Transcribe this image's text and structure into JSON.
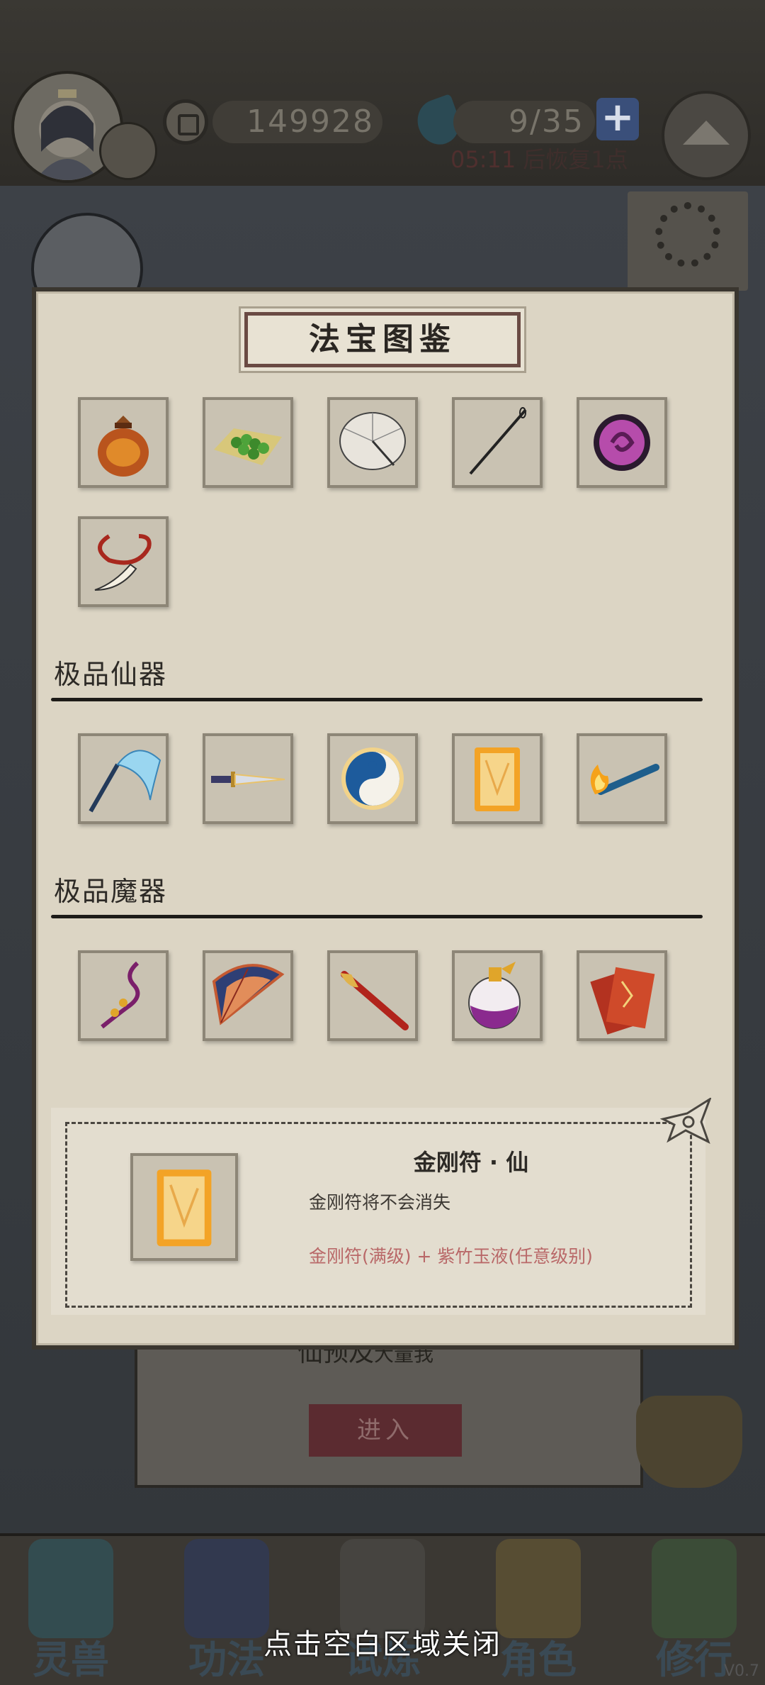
{
  "header": {
    "coins": "149928",
    "stamina": "9/35",
    "add_label": "+",
    "timer": "05:11",
    "timer_suffix": "后恢复1点"
  },
  "modal": {
    "title": "法宝图鉴",
    "sections": [
      {
        "label": "",
        "items": [
          "treasure-bag-icon",
          "jade-beads-icon",
          "paper-umbrella-icon",
          "needle-icon",
          "purple-disc-icon",
          "fang-pendant-icon"
        ]
      },
      {
        "label": "极品仙器",
        "items": [
          "whisk-icon",
          "dagger-icon",
          "yin-yang-icon",
          "golden-talisman-icon",
          "fire-torch-icon"
        ]
      },
      {
        "label": "极品魔器",
        "items": [
          "purple-tassel-icon",
          "blue-fan-icon",
          "red-flute-icon",
          "purple-potion-icon",
          "red-talisman-icon"
        ]
      }
    ],
    "detail": {
      "name": "金刚符 · 仙",
      "description": "金刚符将不会消失",
      "recipe": "金刚符(满级) + 紫竹玉液(任意级别)",
      "icon": "golden-talisman-icon"
    }
  },
  "background": {
    "scroll_title": "仙预及",
    "scroll_suffix": "大量我",
    "enter_label": "进入",
    "settings_label": "设置"
  },
  "nav": {
    "items": [
      "灵兽",
      "功法",
      "试炼场",
      "角色",
      "修行"
    ]
  },
  "close_hint": "点击空白区域关闭",
  "version": "V0.7",
  "colors": {
    "accent_red": "#b96868",
    "modal_bg": "#dcd5c4",
    "rule": "#1d1b18"
  }
}
